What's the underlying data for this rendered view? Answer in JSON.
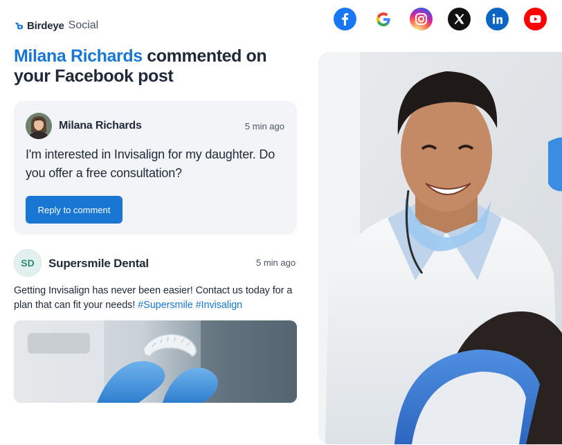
{
  "brand": {
    "name": "Birdeye",
    "product": "Social"
  },
  "socials": [
    {
      "name": "facebook-icon",
      "color": "#1877f2"
    },
    {
      "name": "google-icon",
      "color": "#ffffff"
    },
    {
      "name": "instagram-icon",
      "color": "#d6249f"
    },
    {
      "name": "x-icon",
      "color": "#111111"
    },
    {
      "name": "linkedin-icon",
      "color": "#0a66c2"
    },
    {
      "name": "youtube-icon",
      "color": "#ff0000"
    }
  ],
  "headline": {
    "name": "Milana Richards",
    "rest": " commented on your Facebook post"
  },
  "comment": {
    "author": "Milana Richards",
    "time": "5 min ago",
    "text": "I'm interested in Invisalign for my daughter. Do you offer a free consultation?",
    "reply_label": "Reply to comment"
  },
  "post": {
    "avatar_initials": "SD",
    "author": "Supersmile Dental",
    "time": "5 min ago",
    "text": "Getting Invisalign has never been easier! Contact us today for a plan that can fit your needs! ",
    "hashtags": "#Supersmile #Invisalign"
  },
  "colors": {
    "accent": "#1976d2",
    "card_bg": "#f3f4f7",
    "text": "#1f2937"
  }
}
